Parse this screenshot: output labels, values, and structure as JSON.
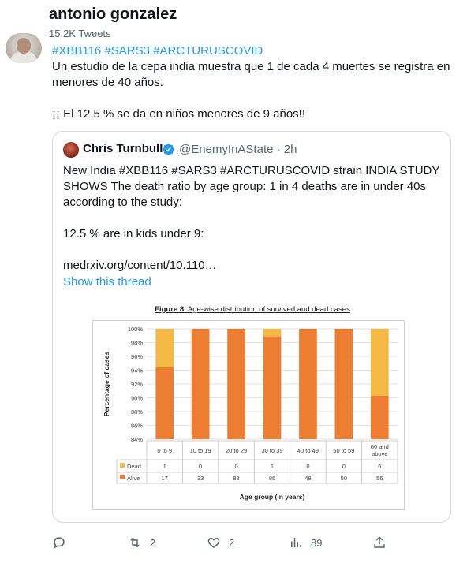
{
  "header": {
    "name": "antonio gonzalez",
    "tweet_count": "15.2K Tweets"
  },
  "tweet": {
    "hashtags": "#XBB116 #SARS3 #ARCTURUSCOVID",
    "line1": "Un estudio de la cepa india muestra que 1 de cada 4 muertes se registra en",
    "line2": "menores de 40 años.",
    "line3": "¡¡ El 12,5 % se da en niños menores de 9 años!!"
  },
  "quote": {
    "name": "Chris Turnbull",
    "handle_time": "@EnemyInAState · 2h",
    "line1": "New India #XBB116 #SARS3 #ARCTURUSCOVID strain INDIA STUDY",
    "line2": "SHOWS The death ratio by age group: 1 in 4 deaths are in under 40s",
    "line3": "according to the study:",
    "line4": "12.5 % are in kids under 9:",
    "line5": "medrxiv.org/content/10.110…",
    "show_thread": "Show this thread"
  },
  "figure": {
    "title_bold": "Figure 8",
    "title_rest": ": Age-wise distribution of survived and dead cases"
  },
  "chart_data": {
    "type": "bar",
    "stacked": true,
    "categories": [
      "0 to 9",
      "10 to 19",
      "20 to 29",
      "30 to 39",
      "40 to 49",
      "50 to 59",
      "60 and above"
    ],
    "category_lines": [
      [
        "0 to 9"
      ],
      [
        "10 to 19"
      ],
      [
        "20 to 29"
      ],
      [
        "30 to 39"
      ],
      [
        "40 to 49"
      ],
      [
        "50 to 59"
      ],
      [
        "60 and",
        "above"
      ]
    ],
    "series": [
      {
        "name": "Alive",
        "color": "#ed7d31",
        "counts": [
          17,
          33,
          88,
          86,
          48,
          50,
          56
        ],
        "values_pct": [
          94.4,
          100,
          100,
          98.9,
          100,
          100,
          90.3
        ]
      },
      {
        "name": "Dead",
        "color": "#f4b942",
        "counts": [
          1,
          0,
          0,
          1,
          0,
          0,
          6
        ],
        "values_pct": [
          5.6,
          0,
          0,
          1.1,
          0,
          0,
          9.7
        ]
      }
    ],
    "ylim": [
      84,
      100
    ],
    "yticks": [
      "84%",
      "86%",
      "88%",
      "90%",
      "92%",
      "94%",
      "96%",
      "98%",
      "100%"
    ],
    "ytick_values": [
      84,
      86,
      88,
      90,
      92,
      94,
      96,
      98,
      100
    ],
    "ylabel": "Percentage of cases",
    "xlabel": "Age group (in years)",
    "grid": true
  },
  "actions": {
    "reply_count": "",
    "retweet_count": "2",
    "like_count": "2",
    "views_count": "89"
  }
}
